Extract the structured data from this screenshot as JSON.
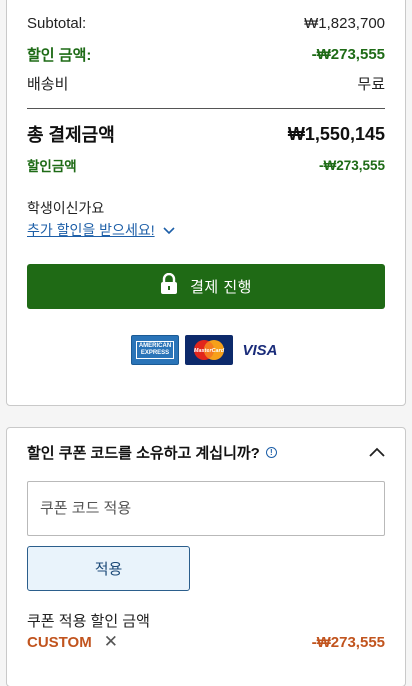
{
  "summary": {
    "subtotal_label": "Subtotal:",
    "subtotal_value": "₩1,823,700",
    "discount_label": "할인 금액:",
    "discount_value": "-₩273,555",
    "shipping_label": "배송비",
    "shipping_value": "무료",
    "total_label": "총 결제금액",
    "total_value": "₩1,550,145",
    "total_discount_label": "할인금액",
    "total_discount_value": "-₩273,555"
  },
  "student": {
    "question": "학생이신가요",
    "link": "추가 할인을 받으세요!"
  },
  "checkout": {
    "pay_label": "결제 진행"
  },
  "payment_cards": [
    "AMERICAN EXPRESS",
    "MasterCard",
    "VISA"
  ],
  "coupon": {
    "question": "할인 쿠폰 코드를 소유하고 계십니까?",
    "input_placeholder": "쿠폰 코드 적용",
    "apply_label": "적용",
    "applied_label": "쿠폰 적용 할인 금액",
    "applied_code": "CUSTOM",
    "applied_value": "-₩273,555"
  },
  "colors": {
    "accent_green": "#1f6a15",
    "discount_green": "#1e6b16",
    "coupon_orange": "#c1541e",
    "link_blue": "#1d5fa8"
  }
}
